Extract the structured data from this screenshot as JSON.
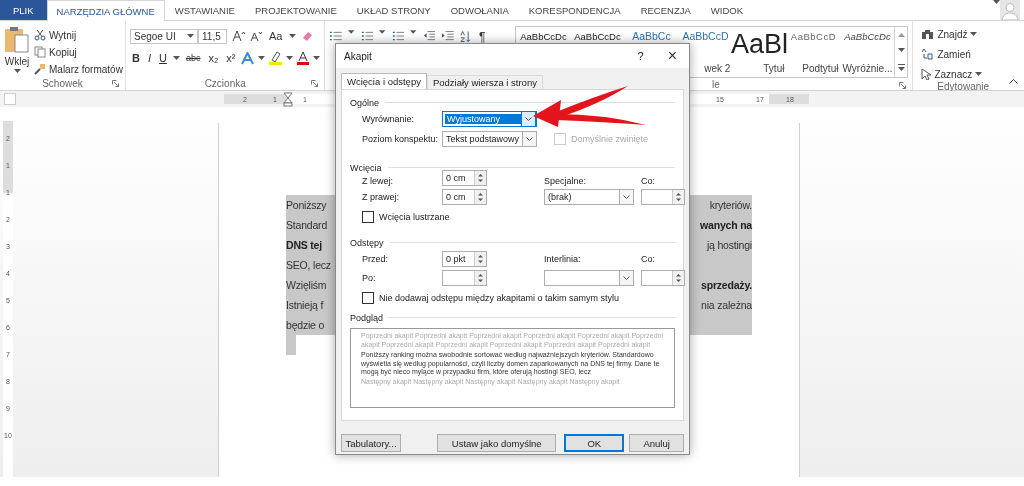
{
  "tabs": [
    {
      "label": "PLIK",
      "kind": "file",
      "selected": false
    },
    {
      "label": "NARZĘDZIA GŁÓWNE",
      "kind": "tab",
      "selected": true
    },
    {
      "label": "WSTAWIANIE",
      "kind": "tab",
      "selected": false
    },
    {
      "label": "PROJEKTOWANIE",
      "kind": "tab",
      "selected": false
    },
    {
      "label": "UKŁAD STRONY",
      "kind": "tab",
      "selected": false
    },
    {
      "label": "ODWOŁANIA",
      "kind": "tab",
      "selected": false
    },
    {
      "label": "KORESPONDENCJA",
      "kind": "tab",
      "selected": false
    },
    {
      "label": "RECENZJA",
      "kind": "tab",
      "selected": false
    },
    {
      "label": "WIDOK",
      "kind": "tab",
      "selected": false
    }
  ],
  "ribbon": {
    "clipboard": {
      "paste": "Wklej",
      "cut": "Wytnij",
      "copy": "Kopiuj",
      "format_painter": "Malarz formatów",
      "label": "Schowek"
    },
    "font": {
      "family": "Segoe UI",
      "size": "11,5",
      "case_button": "Aa",
      "format_buttons": [
        "B",
        "I",
        "U",
        "abc",
        "x₂",
        "x²"
      ],
      "label": "Czcionka"
    },
    "paragraph": {
      "pilcrow": "¶"
    },
    "styles": {
      "label": "le",
      "items": [
        {
          "sample": "AaBbCcDc",
          "kind": "normal"
        },
        {
          "sample": "AaBbCcDc",
          "kind": "normal"
        },
        {
          "sample": "AaBbCc",
          "kind": "heading"
        },
        {
          "sample": "AaBbCcD",
          "kind": "heading",
          "label": "wek 2"
        },
        {
          "sample": "AaBl",
          "kind": "title",
          "label": "Tytuł"
        },
        {
          "sample": "AaBbCcD",
          "kind": "subtitle",
          "label": "Podtytuł"
        },
        {
          "sample": "AaBbCcDc",
          "kind": "emphasis",
          "label": "Wyróżnie..."
        }
      ]
    },
    "editing": {
      "find": "Znajdź",
      "replace": "Zamień",
      "select": "Zaznacz",
      "label": "Edytowanie"
    }
  },
  "ruler": {
    "left_numbers": [
      "2",
      "1",
      "1"
    ],
    "right_numbers": [
      "15",
      "17",
      "18"
    ],
    "vertical_numbers": [
      "2",
      "1",
      "1",
      "2",
      "3",
      "4",
      "5",
      "6",
      "7",
      "8",
      "9",
      "10"
    ]
  },
  "document": {
    "lines": [
      {
        "left": {
          "text": "Poniższy",
          "bold": false
        },
        "right": {
          "text": "kryteriów.",
          "bold": false
        }
      },
      {
        "left": {
          "text": "Standard",
          "bold": false
        },
        "right": {
          "text": "wanych na",
          "bold": true
        }
      },
      {
        "left": {
          "text": "DNS tej",
          "bold": true
        },
        "right": {
          "text": "ją hostingi",
          "bold": false
        }
      },
      {
        "left": {
          "text": "SEO, lecz",
          "bold": false
        }
      },
      {
        "left": {
          "text": "Wzięliśm",
          "bold": false
        },
        "right": {
          "text": "sprzedaży.",
          "bold": true
        }
      },
      {
        "left": {
          "text": "Istnieją f",
          "bold": false
        },
        "right": {
          "text": "nia zależna",
          "bold": false
        }
      },
      {
        "left": {
          "text": "będzie o",
          "bold": false
        }
      }
    ]
  },
  "dialog": {
    "title": "Akapit",
    "help": "?",
    "close": "×",
    "tabs": [
      {
        "label": "Wcięcia i odstępy",
        "selected": true
      },
      {
        "label": "Podziały wiersza i strony",
        "selected": false
      }
    ],
    "general": {
      "heading": "Ogólne",
      "alignment_label": "Wyrównanie:",
      "alignment_value": "Wyjustowany",
      "alignment_focused": true,
      "outline_label": "Poziom konspektu:",
      "outline_value": "Tekst podstawowy",
      "collapsed": {
        "label": "Domyślnie zwinięte",
        "checked": false,
        "disabled": true
      }
    },
    "indents": {
      "heading": "Wcięcia",
      "left_label": "Z lewej:",
      "left_value": "0 cm",
      "right_label": "Z prawej:",
      "right_value": "0 cm",
      "special_label": "Specjalne:",
      "special_value": "(brak)",
      "by_label": "Co:",
      "mirror": {
        "label": "Wcięcia lustrzane",
        "checked": false,
        "disabled": false
      }
    },
    "spacing": {
      "heading": "Odstępy",
      "before_label": "Przed:",
      "before_value": "0 pkt",
      "after_label": "Po:",
      "line_label": "Interlinia:",
      "at_label": "Co:",
      "no_space": {
        "label": "Nie dodawaj odstępu między akapitami o takim samym stylu",
        "checked": false,
        "disabled": false
      }
    },
    "preview": {
      "heading": "Podgląd",
      "previous": [
        "Poprzedni akapit Poprzedni akapit Poprzedni akapit Poprzedni akapit Poprzedni akapit Poprzedni akapit Poprzedni akapit Poprzedni akapit Poprzedni akapit Poprzedni akapit Poprzedni akapit"
      ],
      "sample": "Poniższy ranking można swobodnie sortować według najważniejszych kryteriów. Standardowo wyświetla się według popularności, czyli liczby domen zaparkowanych na DNS tej firmy. Dane te mogą być nieco mylące w przypadku firm, które oferują hostingi SEO, lecz",
      "next": [
        "Następny akapit Następny akapit Następny akapit Następny akapit Następny akapit"
      ]
    },
    "buttons": [
      {
        "label": "Tabulatory...",
        "kind": "normal"
      },
      {
        "label": "Ustaw jako domyślne",
        "kind": "normal"
      },
      {
        "label": "OK",
        "kind": "default"
      },
      {
        "label": "Anuluj",
        "kind": "normal"
      }
    ]
  }
}
